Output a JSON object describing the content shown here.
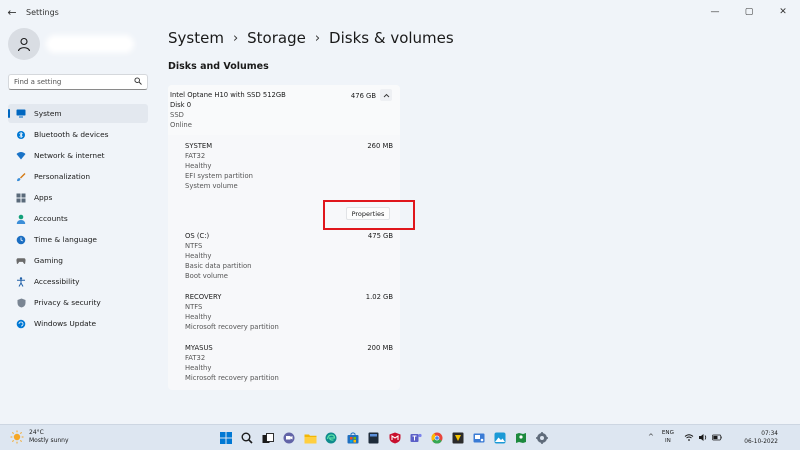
{
  "window": {
    "title": "Settings",
    "back_glyph": "←",
    "minimize_glyph": "—",
    "maximize_glyph": "▢",
    "close_glyph": "✕"
  },
  "sidebar": {
    "search_placeholder": "Find a setting",
    "items": [
      {
        "label": "System",
        "icon": "monitor-icon",
        "color": "#0067c0"
      },
      {
        "label": "Bluetooth & devices",
        "icon": "bluetooth-icon",
        "color": "#0078d4"
      },
      {
        "label": "Network & internet",
        "icon": "wifi-icon",
        "color": "#1a73c7"
      },
      {
        "label": "Personalization",
        "icon": "brush-icon",
        "color": "#d47a16"
      },
      {
        "label": "Apps",
        "icon": "apps-icon",
        "color": "#5a6a7a"
      },
      {
        "label": "Accounts",
        "icon": "person-icon",
        "color": "#13a07a"
      },
      {
        "label": "Time & language",
        "icon": "globe-clock-icon",
        "color": "#1b6ec2"
      },
      {
        "label": "Gaming",
        "icon": "gamepad-icon",
        "color": "#6b6b6b"
      },
      {
        "label": "Accessibility",
        "icon": "accessibility-icon",
        "color": "#1f5fa8"
      },
      {
        "label": "Privacy & security",
        "icon": "shield-icon",
        "color": "#7a8593"
      },
      {
        "label": "Windows Update",
        "icon": "update-icon",
        "color": "#0078d4"
      }
    ]
  },
  "breadcrumb": {
    "part1": "System",
    "part2": "Storage",
    "part3": "Disks & volumes",
    "sep": "›"
  },
  "section_title": "Disks and Volumes",
  "disk": {
    "name": "Intel Optane H10 with SSD 512GB",
    "size": "476 GB",
    "number": "Disk 0",
    "type": "SSD",
    "status": "Online"
  },
  "volumes": [
    {
      "name": "SYSTEM",
      "size": "260 MB",
      "lines": [
        "FAT32",
        "Healthy",
        "EFI system partition",
        "System volume"
      ]
    },
    {
      "name": "OS (C:)",
      "size": "475 GB",
      "lines": [
        "NTFS",
        "Healthy",
        "Basic data partition",
        "Boot volume"
      ]
    },
    {
      "name": "RECOVERY",
      "size": "1.02 GB",
      "lines": [
        "NTFS",
        "Healthy",
        "Microsoft recovery partition"
      ]
    },
    {
      "name": "MYASUS",
      "size": "200 MB",
      "lines": [
        "FAT32",
        "Healthy",
        "Microsoft recovery partition"
      ]
    }
  ],
  "properties_label": "Properties",
  "taskbar": {
    "weather_temp": "24°C",
    "weather_desc": "Mostly sunny",
    "lang_top": "ENG",
    "lang_bottom": "IN",
    "time": "07:34",
    "date": "06-10-2022",
    "tray_chevron": "^",
    "pinned": [
      {
        "name": "start-icon",
        "color": "#0078d4"
      },
      {
        "name": "search-icon",
        "color": "#1a1a1a"
      },
      {
        "name": "task-view-icon",
        "color": "#1a1a1a"
      },
      {
        "name": "chat-icon",
        "color": "#6264a7"
      },
      {
        "name": "file-explorer-icon",
        "color": "#f2b705"
      },
      {
        "name": "edge-icon",
        "color": "#0f8b8d"
      },
      {
        "name": "store-icon",
        "color": "#1f6fbf"
      },
      {
        "name": "calculator-icon",
        "color": "#1d2b3a"
      },
      {
        "name": "mcafee-icon",
        "color": "#c8102e"
      },
      {
        "name": "teams-icon",
        "color": "#5b5fc7"
      },
      {
        "name": "chrome-icon",
        "color": "#e8453c"
      },
      {
        "name": "sticky-app-icon",
        "color": "#2b2b2b"
      },
      {
        "name": "snip-icon",
        "color": "#3a7bd5"
      },
      {
        "name": "photos-icon",
        "color": "#1b9ad6"
      },
      {
        "name": "maps-icon",
        "color": "#1d8a3e"
      },
      {
        "name": "settings-icon",
        "color": "#5f6b7a"
      }
    ]
  }
}
